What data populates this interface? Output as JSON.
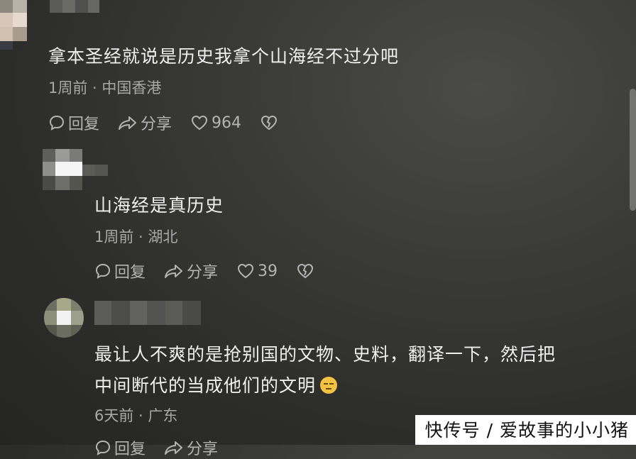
{
  "comments": [
    {
      "text": "拿本圣经就说是历史我拿个山海经不过分吧",
      "meta": "1周前 · 中国香港",
      "reply_label": "回复",
      "share_label": "分享",
      "likes": "964"
    },
    {
      "text": "山海经是真历史",
      "meta": "1周前 · 湖北",
      "reply_label": "回复",
      "share_label": "分享",
      "likes": "39"
    },
    {
      "text_line1": "最让人不爽的是抢别国的文物、史料，翻译一下，然后把",
      "text_line2": "中间断代的当成他们的文明",
      "emoji": "unamused-face-icon",
      "meta": "6天前 · 广东",
      "reply_label": "回复",
      "share_label": "分享"
    }
  ],
  "watermark": "快传号 / 爱故事的小小猪",
  "colors": {
    "background": "#2c2c2a",
    "text": "#f0f0f0",
    "meta": "#a8a8a8",
    "emoji": "#f4c343"
  }
}
